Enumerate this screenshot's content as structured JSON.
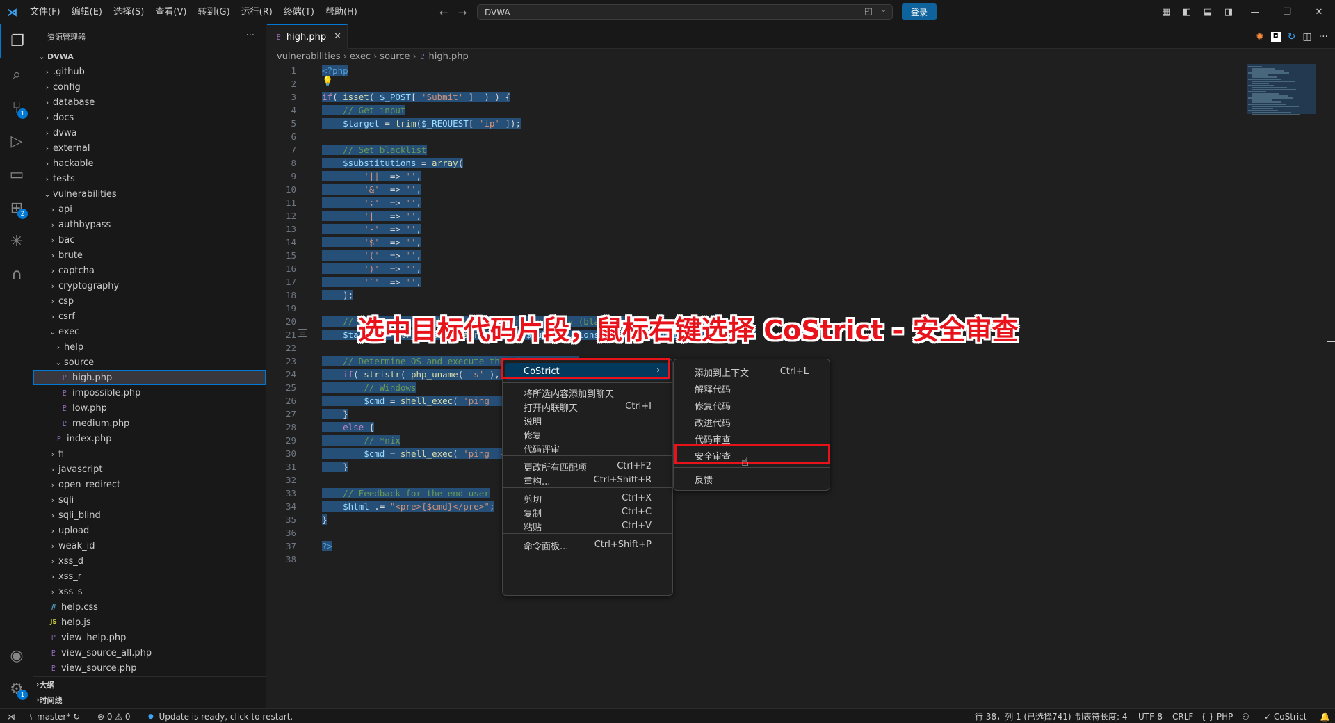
{
  "menu": [
    "文件(F)",
    "编辑(E)",
    "选择(S)",
    "查看(V)",
    "转到(G)",
    "运行(R)",
    "终端(T)",
    "帮助(H)"
  ],
  "search": {
    "value": "DVWA"
  },
  "login_label": "登录",
  "sidebar": {
    "title": "资源管理器",
    "root": "DVWA",
    "tree": [
      {
        "label": ".github",
        "indent": 1,
        "kind": "folder",
        "open": false
      },
      {
        "label": "config",
        "indent": 1,
        "kind": "folder",
        "open": false
      },
      {
        "label": "database",
        "indent": 1,
        "kind": "folder",
        "open": false
      },
      {
        "label": "docs",
        "indent": 1,
        "kind": "folder",
        "open": false
      },
      {
        "label": "dvwa",
        "indent": 1,
        "kind": "folder",
        "open": false
      },
      {
        "label": "external",
        "indent": 1,
        "kind": "folder",
        "open": false
      },
      {
        "label": "hackable",
        "indent": 1,
        "kind": "folder",
        "open": false
      },
      {
        "label": "tests",
        "indent": 1,
        "kind": "folder",
        "open": false
      },
      {
        "label": "vulnerabilities",
        "indent": 1,
        "kind": "folder",
        "open": true
      },
      {
        "label": "api",
        "indent": 2,
        "kind": "folder",
        "open": false
      },
      {
        "label": "authbypass",
        "indent": 2,
        "kind": "folder",
        "open": false
      },
      {
        "label": "bac",
        "indent": 2,
        "kind": "folder",
        "open": false
      },
      {
        "label": "brute",
        "indent": 2,
        "kind": "folder",
        "open": false
      },
      {
        "label": "captcha",
        "indent": 2,
        "kind": "folder",
        "open": false
      },
      {
        "label": "cryptography",
        "indent": 2,
        "kind": "folder",
        "open": false
      },
      {
        "label": "csp",
        "indent": 2,
        "kind": "folder",
        "open": false
      },
      {
        "label": "csrf",
        "indent": 2,
        "kind": "folder",
        "open": false
      },
      {
        "label": "exec",
        "indent": 2,
        "kind": "folder",
        "open": true
      },
      {
        "label": "help",
        "indent": 3,
        "kind": "folder",
        "open": false
      },
      {
        "label": "source",
        "indent": 3,
        "kind": "folder",
        "open": true
      },
      {
        "label": "high.php",
        "indent": 4,
        "kind": "php",
        "selected": true
      },
      {
        "label": "impossible.php",
        "indent": 4,
        "kind": "php"
      },
      {
        "label": "low.php",
        "indent": 4,
        "kind": "php"
      },
      {
        "label": "medium.php",
        "indent": 4,
        "kind": "php"
      },
      {
        "label": "index.php",
        "indent": 3,
        "kind": "php"
      },
      {
        "label": "fi",
        "indent": 2,
        "kind": "folder",
        "open": false
      },
      {
        "label": "javascript",
        "indent": 2,
        "kind": "folder",
        "open": false
      },
      {
        "label": "open_redirect",
        "indent": 2,
        "kind": "folder",
        "open": false
      },
      {
        "label": "sqli",
        "indent": 2,
        "kind": "folder",
        "open": false
      },
      {
        "label": "sqli_blind",
        "indent": 2,
        "kind": "folder",
        "open": false
      },
      {
        "label": "upload",
        "indent": 2,
        "kind": "folder",
        "open": false
      },
      {
        "label": "weak_id",
        "indent": 2,
        "kind": "folder",
        "open": false
      },
      {
        "label": "xss_d",
        "indent": 2,
        "kind": "folder",
        "open": false
      },
      {
        "label": "xss_r",
        "indent": 2,
        "kind": "folder",
        "open": false
      },
      {
        "label": "xss_s",
        "indent": 2,
        "kind": "folder",
        "open": false
      },
      {
        "label": "help.css",
        "indent": 2,
        "kind": "css"
      },
      {
        "label": "help.js",
        "indent": 2,
        "kind": "js"
      },
      {
        "label": "view_help.php",
        "indent": 2,
        "kind": "php"
      },
      {
        "label": "view_source_all.php",
        "indent": 2,
        "kind": "php"
      },
      {
        "label": "view_source.php",
        "indent": 2,
        "kind": "php"
      }
    ],
    "outline_label": "大纲",
    "timeline_label": "时间线"
  },
  "activity_badges": {
    "scm": "1",
    "extensions": "2",
    "settings": "1"
  },
  "tab": {
    "label": "high.php"
  },
  "breadcrumb": [
    "vulnerabilities",
    "exec",
    "source",
    "high.php"
  ],
  "code_lines": [
    {
      "n": "1",
      "t": "<?php"
    },
    {
      "n": "2",
      "t": ""
    },
    {
      "n": "3",
      "t": "if( isset( $_POST[ 'Submit' ]  ) ) {"
    },
    {
      "n": "4",
      "t": "    // Get input"
    },
    {
      "n": "5",
      "t": "    $target = trim($_REQUEST[ 'ip' ]);"
    },
    {
      "n": "6",
      "t": ""
    },
    {
      "n": "7",
      "t": "    // Set blacklist"
    },
    {
      "n": "8",
      "t": "    $substitutions = array("
    },
    {
      "n": "9",
      "t": "        '||' => '',"
    },
    {
      "n": "10",
      "t": "        '&'  => '',"
    },
    {
      "n": "11",
      "t": "        ';'  => '',"
    },
    {
      "n": "12",
      "t": "        '| ' => '',"
    },
    {
      "n": "13",
      "t": "        '-'  => '',"
    },
    {
      "n": "14",
      "t": "        '$'  => '',"
    },
    {
      "n": "15",
      "t": "        '('  => '',"
    },
    {
      "n": "16",
      "t": "        ')'  => '',"
    },
    {
      "n": "17",
      "t": "        '`'  => '',"
    },
    {
      "n": "18",
      "t": "    );"
    },
    {
      "n": "19",
      "t": ""
    },
    {
      "n": "20",
      "t": "    // Remove any of the characters in the array (blacklist)."
    },
    {
      "n": "21",
      "t": "    $target = str_replace( array_keys( $substitutions ), $substitutions, $target );"
    },
    {
      "n": "22",
      "t": ""
    },
    {
      "n": "23",
      "t": "    // Determine OS and execute the ping command."
    },
    {
      "n": "24",
      "t": "    if( stristr( php_uname( 's' ), 'Windows NT' ) ) {"
    },
    {
      "n": "25",
      "t": "        // Windows"
    },
    {
      "n": "26",
      "t": "        $cmd = shell_exec( 'ping  ' . $target );"
    },
    {
      "n": "27",
      "t": "    }"
    },
    {
      "n": "28",
      "t": "    else {"
    },
    {
      "n": "29",
      "t": "        // *nix"
    },
    {
      "n": "30",
      "t": "        $cmd = shell_exec( 'ping  -c 4 ' . $target );"
    },
    {
      "n": "31",
      "t": "    }"
    },
    {
      "n": "32",
      "t": ""
    },
    {
      "n": "33",
      "t": "    // Feedback for the end user"
    },
    {
      "n": "34",
      "t": "    $html .= \"<pre>{$cmd}</pre>\";"
    },
    {
      "n": "35",
      "t": "}"
    },
    {
      "n": "36",
      "t": ""
    },
    {
      "n": "37",
      "t": "?>"
    },
    {
      "n": "38",
      "t": ""
    }
  ],
  "annotation": "选中目标代码片段，鼠标右键选择 CoStrict - 安全审查",
  "context_menu": {
    "items": [
      {
        "label": "CoStrict",
        "kb": "",
        "submenu": true
      },
      {
        "label": "将所选内容添加到聊天",
        "kb": ""
      },
      {
        "label": "打开内联聊天",
        "kb": "Ctrl+I"
      },
      {
        "label": "说明",
        "kb": ""
      },
      {
        "label": "修复",
        "kb": ""
      },
      {
        "label": "代码评审",
        "kb": ""
      },
      {
        "label": "更改所有匹配项",
        "kb": "Ctrl+F2"
      },
      {
        "label": "重构...",
        "kb": "Ctrl+Shift+R"
      },
      {
        "label": "剪切",
        "kb": "Ctrl+X"
      },
      {
        "label": "复制",
        "kb": "Ctrl+C"
      },
      {
        "label": "粘贴",
        "kb": "Ctrl+V"
      },
      {
        "label": "命令面板...",
        "kb": "Ctrl+Shift+P"
      }
    ]
  },
  "submenu": {
    "items": [
      {
        "label": "添加到上下文",
        "kb": "Ctrl+L"
      },
      {
        "label": "解释代码",
        "kb": ""
      },
      {
        "label": "修复代码",
        "kb": ""
      },
      {
        "label": "改进代码",
        "kb": ""
      },
      {
        "label": "代码审查",
        "kb": ""
      },
      {
        "label": "安全审查",
        "kb": ""
      },
      {
        "label": "反馈",
        "kb": ""
      }
    ]
  },
  "statusbar": {
    "branch": "master*",
    "problems": "0",
    "warnings": "0",
    "update": "Update is ready, click to restart.",
    "position": "行 38，列 1 (已选择741)",
    "tab_size": "制表符长度: 4",
    "encoding": "UTF-8",
    "eol": "CRLF",
    "language": "PHP",
    "costrict": "CoStrict"
  },
  "colors": {
    "accent": "#0078d4",
    "annotation": "#e8121b",
    "selection": "#264f78"
  }
}
